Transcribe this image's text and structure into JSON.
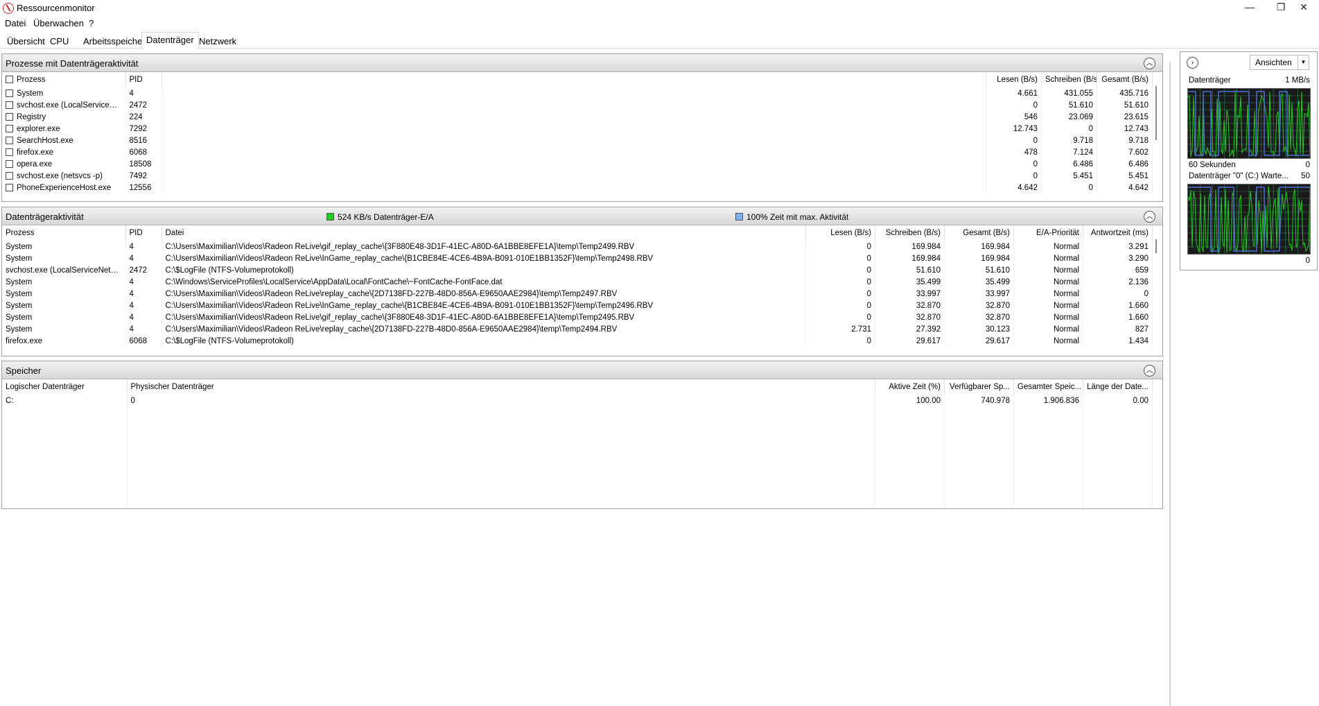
{
  "window": {
    "title": "Ressourcenmonitor",
    "controls": {
      "minimize": "—",
      "maximize": "❐",
      "close": "✕"
    }
  },
  "menu": [
    "Datei",
    "Überwachen",
    "?"
  ],
  "tabs": [
    "Übersicht",
    "CPU",
    "Arbeitsspeicher",
    "Datenträger",
    "Netzwerk"
  ],
  "active_tab": "Datenträger",
  "processes": {
    "title": "Prozesse mit Datenträgeraktivität",
    "columns": [
      "Prozess",
      "PID",
      "Lesen (B/s)",
      "Schreiben (B/s)",
      "Gesamt (B/s)"
    ],
    "rows": [
      [
        "System",
        "4",
        "4.661",
        "431.055",
        "435.716"
      ],
      [
        "svchost.exe (LocalServiceNet...",
        "2472",
        "0",
        "51.610",
        "51.610"
      ],
      [
        "Registry",
        "224",
        "546",
        "23.069",
        "23.615"
      ],
      [
        "explorer.exe",
        "7292",
        "12.743",
        "0",
        "12.743"
      ],
      [
        "SearchHost.exe",
        "8516",
        "0",
        "9.718",
        "9.718"
      ],
      [
        "firefox.exe",
        "6068",
        "478",
        "7.124",
        "7.602"
      ],
      [
        "opera.exe",
        "18508",
        "0",
        "6.486",
        "6.486"
      ],
      [
        "svchost.exe (netsvcs -p)",
        "7492",
        "0",
        "5.451",
        "5.451"
      ],
      [
        "PhoneExperienceHost.exe",
        "12556",
        "4.642",
        "0",
        "4.642"
      ]
    ]
  },
  "activity": {
    "title": "Datenträgeraktivität",
    "legend_io": "524 KB/s Datenträger-E/A",
    "legend_time": "100% Zeit mit max. Aktivität",
    "legend_io_color": "#22cc22",
    "legend_time_color": "#7fb2f0",
    "columns": [
      "Prozess",
      "PID",
      "Datei",
      "Lesen (B/s)",
      "Schreiben (B/s)",
      "Gesamt (B/s)",
      "E/A-Priorität",
      "Antwortzeit (ms)"
    ],
    "rows": [
      [
        "System",
        "4",
        "C:\\Users\\Maximilian\\Videos\\Radeon ReLive\\gif_replay_cache\\{3F880E48-3D1F-41EC-A80D-6A1BBE8EFE1A}\\temp\\Temp2499.RBV",
        "0",
        "169.984",
        "169.984",
        "Normal",
        "3.291"
      ],
      [
        "System",
        "4",
        "C:\\Users\\Maximilian\\Videos\\Radeon ReLive\\InGame_replay_cache\\{B1CBE84E-4CE6-4B9A-B091-010E1BB1352F}\\temp\\Temp2498.RBV",
        "0",
        "169.984",
        "169.984",
        "Normal",
        "3.290"
      ],
      [
        "svchost.exe (LocalServiceNetwo...",
        "2472",
        "C:\\$LogFile (NTFS-Volumeprotokoll)",
        "0",
        "51.610",
        "51.610",
        "Normal",
        "659"
      ],
      [
        "System",
        "4",
        "C:\\Windows\\ServiceProfiles\\LocalService\\AppData\\Local\\FontCache\\~FontCache-FontFace.dat",
        "0",
        "35.499",
        "35.499",
        "Normal",
        "2.136"
      ],
      [
        "System",
        "4",
        "C:\\Users\\Maximilian\\Videos\\Radeon ReLive\\replay_cache\\{2D7138FD-227B-48D0-856A-E9650AAE2984}\\temp\\Temp2497.RBV",
        "0",
        "33.997",
        "33.997",
        "Normal",
        "0"
      ],
      [
        "System",
        "4",
        "C:\\Users\\Maximilian\\Videos\\Radeon ReLive\\InGame_replay_cache\\{B1CBE84E-4CE6-4B9A-B091-010E1BB1352F}\\temp\\Temp2496.RBV",
        "0",
        "32.870",
        "32.870",
        "Normal",
        "1.660"
      ],
      [
        "System",
        "4",
        "C:\\Users\\Maximilian\\Videos\\Radeon ReLive\\gif_replay_cache\\{3F880E48-3D1F-41EC-A80D-6A1BBE8EFE1A}\\temp\\Temp2495.RBV",
        "0",
        "32.870",
        "32.870",
        "Normal",
        "1.660"
      ],
      [
        "System",
        "4",
        "C:\\Users\\Maximilian\\Videos\\Radeon ReLive\\replay_cache\\{2D7138FD-227B-48D0-856A-E9650AAE2984}\\temp\\Temp2494.RBV",
        "2.731",
        "27.392",
        "30.123",
        "Normal",
        "827"
      ],
      [
        "firefox.exe",
        "6068",
        "C:\\$LogFile (NTFS-Volumeprotokoll)",
        "0",
        "29.617",
        "29.617",
        "Normal",
        "1.434"
      ]
    ]
  },
  "storage": {
    "title": "Speicher",
    "columns": [
      "Logischer Datenträger",
      "Physischer Datenträger",
      "Aktive Zeit (%)",
      "Verfügbarer Sp...",
      "Gesamter Speic...",
      "Länge der Date..."
    ],
    "rows": [
      [
        "C:",
        "0",
        "100.00",
        "740.978",
        "1.906.836",
        "0.00"
      ]
    ]
  },
  "right_panel": {
    "views_button": "Ansichten",
    "graph1": {
      "title": "Datenträger",
      "scale_max": "1 MB/s",
      "footer_left": "60 Sekunden",
      "footer_right": "0"
    },
    "graph2": {
      "title": "Datenträger \"0\" (C:) Warte...",
      "scale_max": "50",
      "footer_right": "0"
    },
    "colors": {
      "green": "#22cc22",
      "blue": "#4a6fd8",
      "grid": "#2e8b57"
    }
  }
}
